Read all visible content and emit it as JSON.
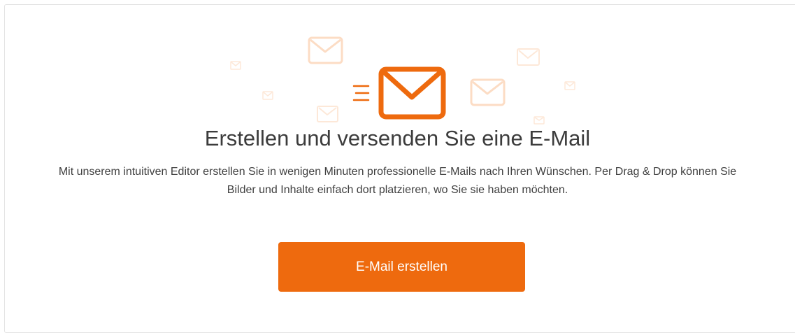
{
  "empty_state": {
    "title": "Erstellen und versenden Sie eine E-Mail",
    "description": "Mit unserem intuitiven Editor erstellen Sie in wenigen Minuten professionelle E-Mails nach Ihren Wünschen. Per Drag & Drop können Sie Bilder und Inhalte einfach dort platzieren, wo Sie sie haben möchten.",
    "cta_label": "E-Mail erstellen"
  },
  "illustration": {
    "main_icon": "envelope-icon",
    "motion_icon": "speed-lines-icon",
    "background_icons": "envelope-icon"
  },
  "colors": {
    "accent": "#ee6a0e",
    "accent_faded": "#fcdcc4",
    "accent_faded_light": "#fde8d8",
    "text": "#3c3c3c",
    "border": "#e3e3e3"
  }
}
